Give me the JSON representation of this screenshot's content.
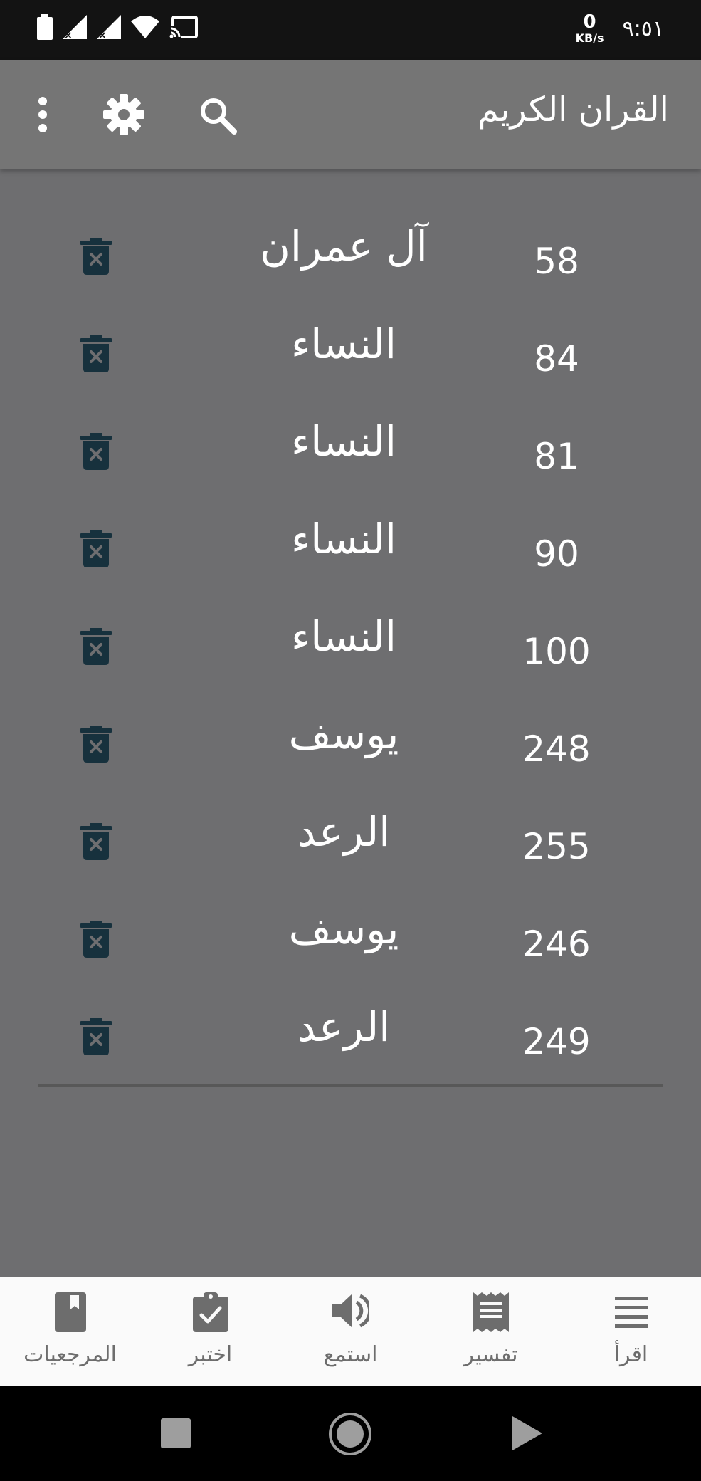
{
  "status_bar": {
    "net_speed_value": "0",
    "net_speed_unit": "KB/s",
    "time": "٩:٥١"
  },
  "app_bar": {
    "title": "القران الكريم",
    "icons": [
      "search-icon",
      "gear-icon",
      "more-vert-icon"
    ]
  },
  "bookmarks": [
    {
      "surah": "آل عمران",
      "page": "58"
    },
    {
      "surah": "النساء",
      "page": "84"
    },
    {
      "surah": "النساء",
      "page": "81"
    },
    {
      "surah": "النساء",
      "page": "90"
    },
    {
      "surah": "النساء",
      "page": "100"
    },
    {
      "surah": "يوسف",
      "page": "248"
    },
    {
      "surah": "الرعد",
      "page": "255"
    },
    {
      "surah": "يوسف",
      "page": "246"
    },
    {
      "surah": "الرعد",
      "page": "249"
    }
  ],
  "bottom_nav": {
    "items": [
      {
        "label": "المرجعيات",
        "icon": "bookmark-icon"
      },
      {
        "label": "اختبر",
        "icon": "clipboard-check-icon"
      },
      {
        "label": "استمع",
        "icon": "speaker-icon"
      },
      {
        "label": "تفسير",
        "icon": "receipt-icon"
      },
      {
        "label": "اقرأ",
        "icon": "list-icon"
      }
    ]
  },
  "colors": {
    "background": "#6e6e70",
    "app_bar": "#757575",
    "trash_icon": "#17313d",
    "bottom_nav_bg": "#fafafa",
    "bottom_nav_text": "#6d6d6d"
  }
}
